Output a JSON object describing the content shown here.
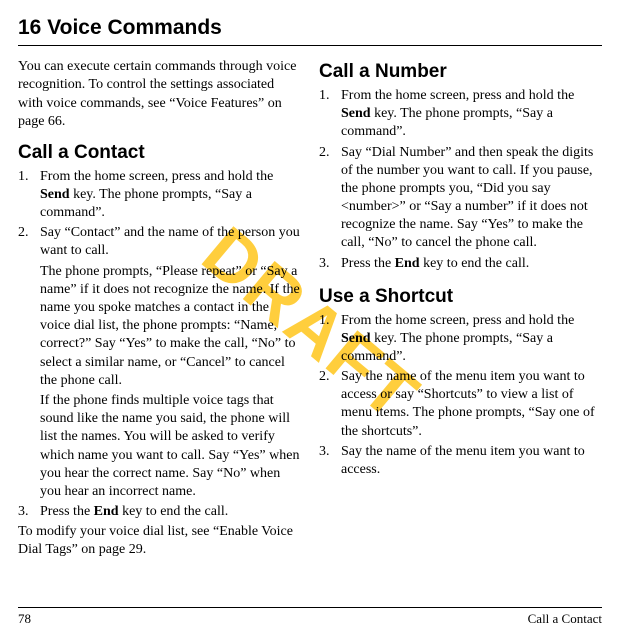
{
  "watermark": "DRAFT",
  "chapter": "16   Voice Commands",
  "intro": "You can execute certain commands through voice recognition. To control the settings associated with voice commands, see “Voice Features” on page 66.",
  "callContact": {
    "title": "Call a Contact",
    "step1_a": "From the home screen, press and hold the ",
    "step1_bold": "Send",
    "step1_b": " key. The phone prompts, “Say a command”.",
    "step2": "Say “Contact” and the name of the person you want to call.",
    "sub1": "The phone prompts, “Please repeat” or “Say a name” if it does not recognize the name. If the name you spoke matches a contact in the voice dial list, the phone prompts: “Name, correct?” Say “Yes” to make the call, “No” to select a similar name, or “Cancel” to cancel the phone call.",
    "sub2": "If the phone finds multiple voice tags that sound like the name you said, the phone will list the names. You will be asked to verify which name you want to call. Say “Yes” when you hear the correct name. Say “No” when you hear an incorrect name.",
    "step3_a": "Press the ",
    "step3_bold": "End",
    "step3_b": " key to end the call.",
    "outro": "To modify your voice dial list, see “Enable Voice Dial Tags” on page 29."
  },
  "callNumber": {
    "title": "Call a Number",
    "step1_a": "From the home screen, press and hold the ",
    "step1_bold": "Send",
    "step1_b": " key. The phone prompts, “Say a command”.",
    "step2": "Say “Dial Number” and then speak the digits of the number you want to call. If you pause, the phone prompts you, “Did you say <number>” or “Say a number” if it does not recognize the name. Say “Yes” to make the call, “No” to cancel the phone call.",
    "step3_a": "Press the ",
    "step3_bold": "End",
    "step3_b": " key to end the call."
  },
  "shortcut": {
    "title": "Use a Shortcut",
    "step1_a": "From the home screen, press and hold the ",
    "step1_bold": "Send",
    "step1_b": " key. The phone prompts, “Say a command”.",
    "step2": "Say the name of the menu item you want to access or say “Shortcuts” to view a list of menu items. The phone prompts, “Say one of the shortcuts”.",
    "step3": "Say the name of the menu item you want to access."
  },
  "footer": {
    "page": "78",
    "section": "Call a Contact"
  }
}
